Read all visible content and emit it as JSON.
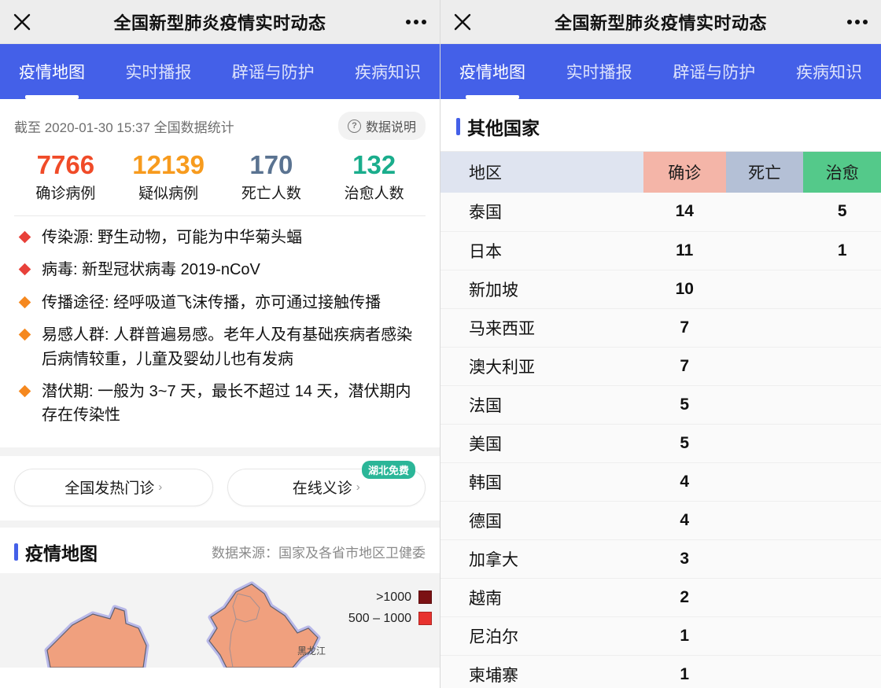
{
  "window": {
    "title": "全国新型肺炎疫情实时动态",
    "close_icon": "close-icon",
    "more_icon": "more-dots-icon"
  },
  "tabs": [
    {
      "label": "疫情地图",
      "active": true
    },
    {
      "label": "实时播报",
      "active": false
    },
    {
      "label": "辟谣与防护",
      "active": false
    },
    {
      "label": "疾病知识",
      "active": false
    }
  ],
  "colors": {
    "tabbar": "#4460E8",
    "navbar": "#ededed",
    "confirmed": "#F04B28",
    "suspected": "#F79B1E",
    "deaths": "#5A7391",
    "cured": "#1AAD8C",
    "accent": "#4460E8",
    "badge_green": "#2BB698",
    "bullet_red": "#E8413A",
    "bullet_orange": "#F5881F"
  },
  "stats_card": {
    "as_of": "截至 2020-01-30 15:37 全国数据统计",
    "data_note_label": "数据说明",
    "data_note_icon": "question-circle-icon",
    "items": [
      {
        "value": "7766",
        "label": "确诊病例",
        "color": "#F04B28"
      },
      {
        "value": "12139",
        "label": "疑似病例",
        "color": "#F79B1E"
      },
      {
        "value": "170",
        "label": "死亡人数",
        "color": "#5A7391"
      },
      {
        "value": "132",
        "label": "治愈人数",
        "color": "#1AAD8C"
      }
    ]
  },
  "facts": [
    {
      "text": "传染源: 野生动物，可能为中华菊头蝠",
      "bullet_color": "#E8413A"
    },
    {
      "text": "病毒: 新型冠状病毒 2019-nCoV",
      "bullet_color": "#E8413A"
    },
    {
      "text": "传播途径: 经呼吸道飞沫传播，亦可通过接触传播",
      "bullet_color": "#F5881F"
    },
    {
      "text": "易感人群: 人群普遍易感。老年人及有基础疾病者感染后病情较重，儿童及婴幼儿也有发病",
      "bullet_color": "#F5881F"
    },
    {
      "text": "潜伏期: 一般为 3~7 天，最长不超过 14 天，潜伏期内存在传染性",
      "bullet_color": "#F5881F"
    }
  ],
  "actions": [
    {
      "label": "全国发热门诊",
      "chevron": "›",
      "badge": null
    },
    {
      "label": "在线义诊",
      "chevron": "›",
      "badge": "湖北免费"
    }
  ],
  "map_section": {
    "title": "疫情地图",
    "source": "数据来源：国家及各省市地区卫健委",
    "province_label": "黑龙江",
    "legend": [
      {
        "label": ">1000",
        "color": "#7B1113"
      },
      {
        "label": "500 – 1000",
        "color": "#E8322E"
      }
    ]
  },
  "other_countries": {
    "title": "其他国家",
    "columns": [
      "地区",
      "确诊",
      "死亡",
      "治愈"
    ],
    "column_colors": [
      "#dfe4f0",
      "#f4b5a8",
      "#b4c0d6",
      "#54c98a"
    ],
    "rows": [
      {
        "region": "泰国",
        "confirmed": "14",
        "deaths": "",
        "cured": "5"
      },
      {
        "region": "日本",
        "confirmed": "11",
        "deaths": "",
        "cured": "1"
      },
      {
        "region": "新加坡",
        "confirmed": "10",
        "deaths": "",
        "cured": ""
      },
      {
        "region": "马来西亚",
        "confirmed": "7",
        "deaths": "",
        "cured": ""
      },
      {
        "region": "澳大利亚",
        "confirmed": "7",
        "deaths": "",
        "cured": ""
      },
      {
        "region": "法国",
        "confirmed": "5",
        "deaths": "",
        "cured": ""
      },
      {
        "region": "美国",
        "confirmed": "5",
        "deaths": "",
        "cured": ""
      },
      {
        "region": "韩国",
        "confirmed": "4",
        "deaths": "",
        "cured": ""
      },
      {
        "region": "德国",
        "confirmed": "4",
        "deaths": "",
        "cured": ""
      },
      {
        "region": "加拿大",
        "confirmed": "3",
        "deaths": "",
        "cured": ""
      },
      {
        "region": "越南",
        "confirmed": "2",
        "deaths": "",
        "cured": ""
      },
      {
        "region": "尼泊尔",
        "confirmed": "1",
        "deaths": "",
        "cured": ""
      },
      {
        "region": "柬埔寨",
        "confirmed": "1",
        "deaths": "",
        "cured": ""
      }
    ]
  }
}
